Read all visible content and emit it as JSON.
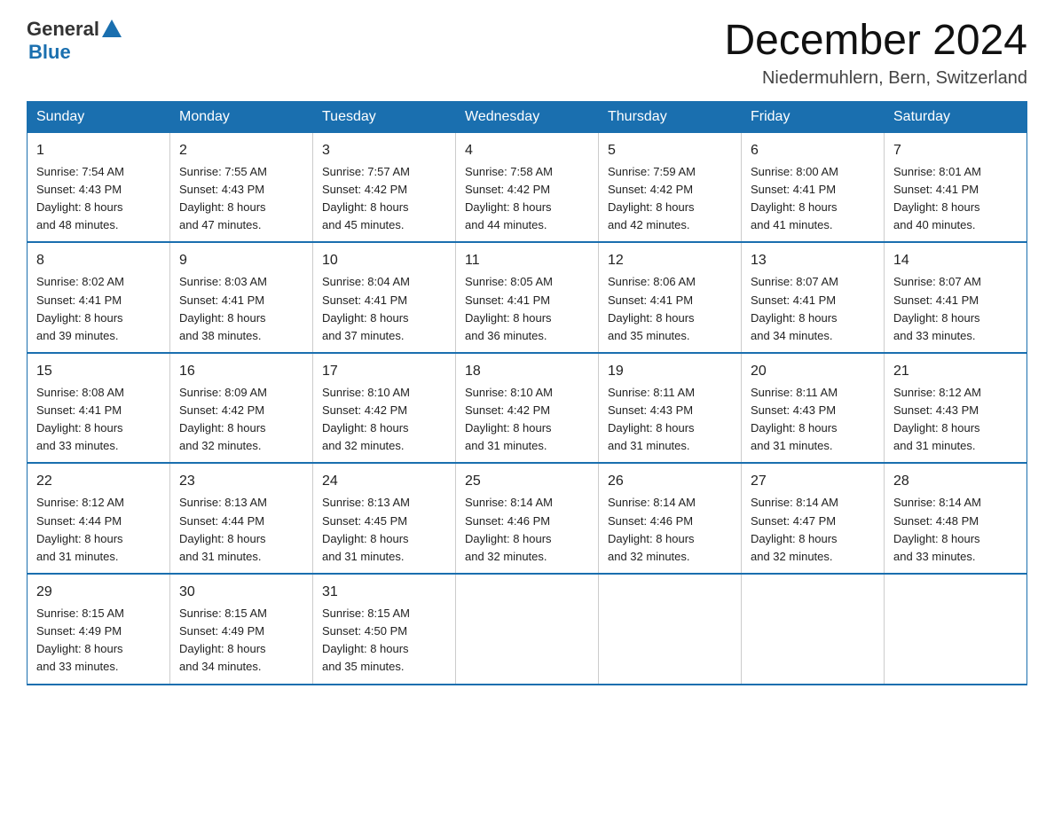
{
  "header": {
    "logo_general": "General",
    "logo_blue": "Blue",
    "month_title": "December 2024",
    "location": "Niedermuhlern, Bern, Switzerland"
  },
  "days_of_week": [
    "Sunday",
    "Monday",
    "Tuesday",
    "Wednesday",
    "Thursday",
    "Friday",
    "Saturday"
  ],
  "weeks": [
    [
      {
        "day": "1",
        "sunrise": "7:54 AM",
        "sunset": "4:43 PM",
        "daylight": "8 hours and 48 minutes."
      },
      {
        "day": "2",
        "sunrise": "7:55 AM",
        "sunset": "4:43 PM",
        "daylight": "8 hours and 47 minutes."
      },
      {
        "day": "3",
        "sunrise": "7:57 AM",
        "sunset": "4:42 PM",
        "daylight": "8 hours and 45 minutes."
      },
      {
        "day": "4",
        "sunrise": "7:58 AM",
        "sunset": "4:42 PM",
        "daylight": "8 hours and 44 minutes."
      },
      {
        "day": "5",
        "sunrise": "7:59 AM",
        "sunset": "4:42 PM",
        "daylight": "8 hours and 42 minutes."
      },
      {
        "day": "6",
        "sunrise": "8:00 AM",
        "sunset": "4:41 PM",
        "daylight": "8 hours and 41 minutes."
      },
      {
        "day": "7",
        "sunrise": "8:01 AM",
        "sunset": "4:41 PM",
        "daylight": "8 hours and 40 minutes."
      }
    ],
    [
      {
        "day": "8",
        "sunrise": "8:02 AM",
        "sunset": "4:41 PM",
        "daylight": "8 hours and 39 minutes."
      },
      {
        "day": "9",
        "sunrise": "8:03 AM",
        "sunset": "4:41 PM",
        "daylight": "8 hours and 38 minutes."
      },
      {
        "day": "10",
        "sunrise": "8:04 AM",
        "sunset": "4:41 PM",
        "daylight": "8 hours and 37 minutes."
      },
      {
        "day": "11",
        "sunrise": "8:05 AM",
        "sunset": "4:41 PM",
        "daylight": "8 hours and 36 minutes."
      },
      {
        "day": "12",
        "sunrise": "8:06 AM",
        "sunset": "4:41 PM",
        "daylight": "8 hours and 35 minutes."
      },
      {
        "day": "13",
        "sunrise": "8:07 AM",
        "sunset": "4:41 PM",
        "daylight": "8 hours and 34 minutes."
      },
      {
        "day": "14",
        "sunrise": "8:07 AM",
        "sunset": "4:41 PM",
        "daylight": "8 hours and 33 minutes."
      }
    ],
    [
      {
        "day": "15",
        "sunrise": "8:08 AM",
        "sunset": "4:41 PM",
        "daylight": "8 hours and 33 minutes."
      },
      {
        "day": "16",
        "sunrise": "8:09 AM",
        "sunset": "4:42 PM",
        "daylight": "8 hours and 32 minutes."
      },
      {
        "day": "17",
        "sunrise": "8:10 AM",
        "sunset": "4:42 PM",
        "daylight": "8 hours and 32 minutes."
      },
      {
        "day": "18",
        "sunrise": "8:10 AM",
        "sunset": "4:42 PM",
        "daylight": "8 hours and 31 minutes."
      },
      {
        "day": "19",
        "sunrise": "8:11 AM",
        "sunset": "4:43 PM",
        "daylight": "8 hours and 31 minutes."
      },
      {
        "day": "20",
        "sunrise": "8:11 AM",
        "sunset": "4:43 PM",
        "daylight": "8 hours and 31 minutes."
      },
      {
        "day": "21",
        "sunrise": "8:12 AM",
        "sunset": "4:43 PM",
        "daylight": "8 hours and 31 minutes."
      }
    ],
    [
      {
        "day": "22",
        "sunrise": "8:12 AM",
        "sunset": "4:44 PM",
        "daylight": "8 hours and 31 minutes."
      },
      {
        "day": "23",
        "sunrise": "8:13 AM",
        "sunset": "4:44 PM",
        "daylight": "8 hours and 31 minutes."
      },
      {
        "day": "24",
        "sunrise": "8:13 AM",
        "sunset": "4:45 PM",
        "daylight": "8 hours and 31 minutes."
      },
      {
        "day": "25",
        "sunrise": "8:14 AM",
        "sunset": "4:46 PM",
        "daylight": "8 hours and 32 minutes."
      },
      {
        "day": "26",
        "sunrise": "8:14 AM",
        "sunset": "4:46 PM",
        "daylight": "8 hours and 32 minutes."
      },
      {
        "day": "27",
        "sunrise": "8:14 AM",
        "sunset": "4:47 PM",
        "daylight": "8 hours and 32 minutes."
      },
      {
        "day": "28",
        "sunrise": "8:14 AM",
        "sunset": "4:48 PM",
        "daylight": "8 hours and 33 minutes."
      }
    ],
    [
      {
        "day": "29",
        "sunrise": "8:15 AM",
        "sunset": "4:49 PM",
        "daylight": "8 hours and 33 minutes."
      },
      {
        "day": "30",
        "sunrise": "8:15 AM",
        "sunset": "4:49 PM",
        "daylight": "8 hours and 34 minutes."
      },
      {
        "day": "31",
        "sunrise": "8:15 AM",
        "sunset": "4:50 PM",
        "daylight": "8 hours and 35 minutes."
      },
      null,
      null,
      null,
      null
    ]
  ],
  "labels": {
    "sunrise": "Sunrise:",
    "sunset": "Sunset:",
    "daylight": "Daylight:"
  }
}
